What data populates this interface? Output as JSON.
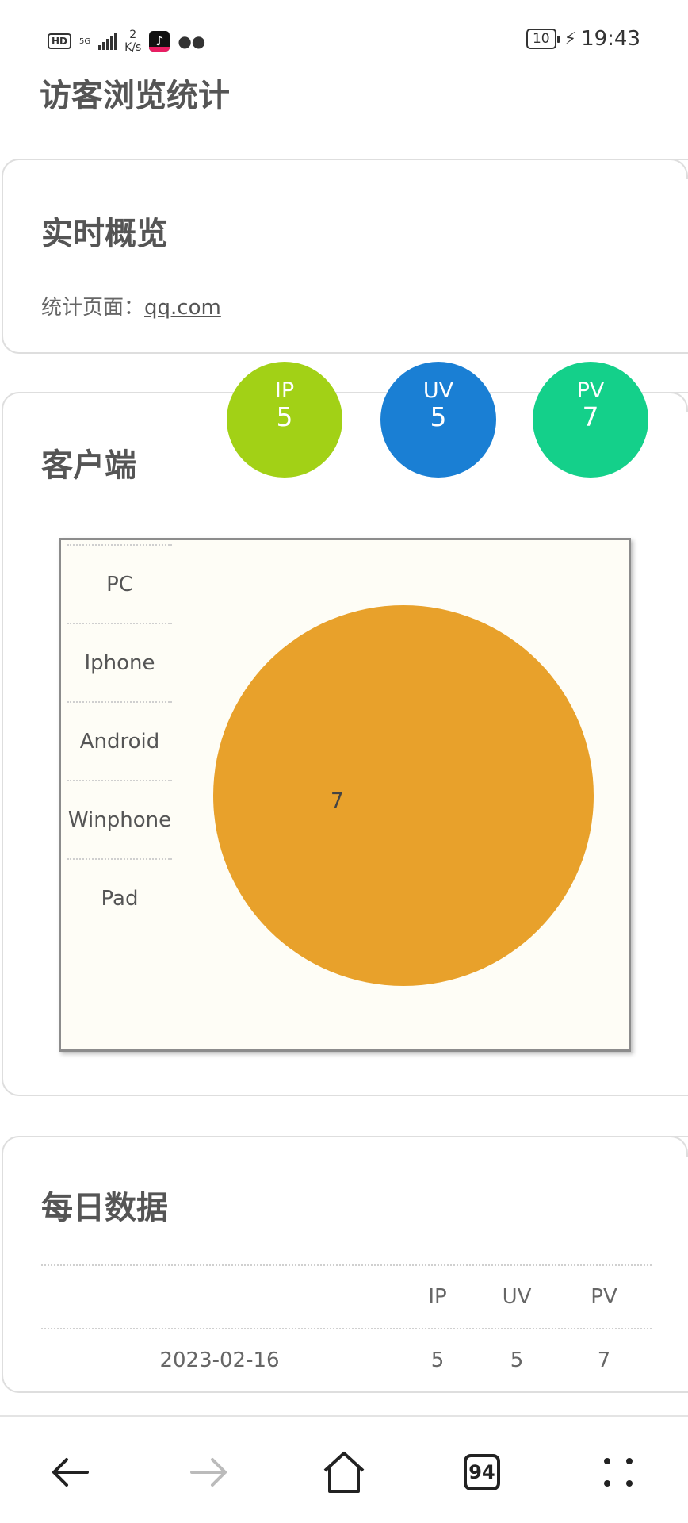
{
  "status_bar": {
    "hd": "HD",
    "network": "5G",
    "speed_value": "2",
    "speed_unit": "K/s",
    "battery": "10",
    "time": "19:43"
  },
  "page": {
    "title": "访客浏览统计"
  },
  "overview": {
    "title": "实时概览",
    "stat_label": "统计页面：",
    "stat_link": "qq.com"
  },
  "stats": [
    {
      "label": "IP",
      "value": "5",
      "color": "#a2d116"
    },
    {
      "label": "UV",
      "value": "5",
      "color": "#1a7fd4"
    },
    {
      "label": "PV",
      "value": "7",
      "color": "#14d08a"
    }
  ],
  "client": {
    "title": "客户端",
    "legend": [
      "PC",
      "Iphone",
      "Android",
      "Winphone",
      "Pad"
    ]
  },
  "chart_data": {
    "type": "pie",
    "categories": [
      "PC",
      "Iphone",
      "Android",
      "Winphone",
      "Pad"
    ],
    "values": [
      7,
      0,
      0,
      0,
      0
    ],
    "slice_label": "7",
    "colors": [
      "#e8a12b"
    ],
    "legend_placement": "left"
  },
  "daily": {
    "title": "每日数据",
    "columns": [
      "",
      "IP",
      "UV",
      "PV"
    ],
    "rows": [
      {
        "date": "2023-02-16",
        "ip": "5",
        "uv": "5",
        "pv": "7"
      }
    ]
  },
  "bottom_nav": {
    "tabs_count": "94"
  }
}
